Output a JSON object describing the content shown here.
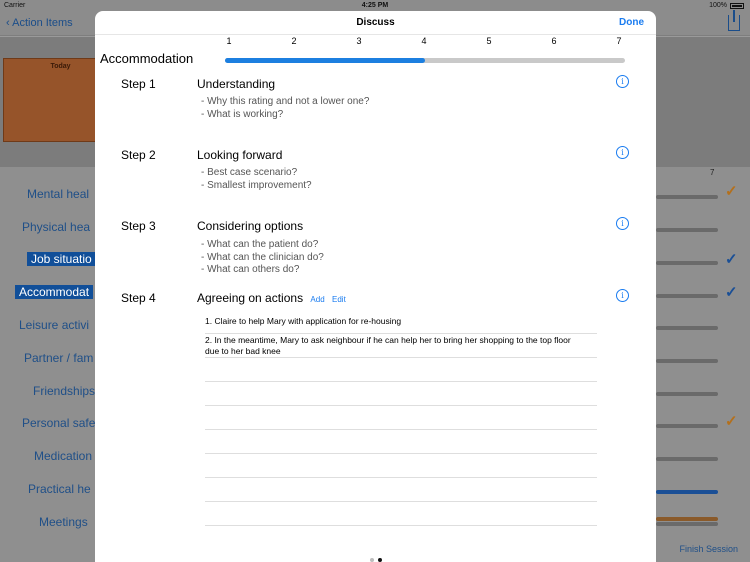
{
  "status": {
    "carrier": "Carrier",
    "time": "4:25 PM",
    "battery": "100%"
  },
  "nav": {
    "back_label": "Action Items"
  },
  "background": {
    "today_label": "Today",
    "items": [
      "Mental heal",
      "Physical hea",
      "Job situatio",
      "Accommodat",
      "Leisure activi",
      "Partner / fam",
      "Friendships",
      "Personal safe",
      "Medication",
      "Practical he",
      "Meetings"
    ],
    "scale_max_label": "7",
    "finish_label": "Finish Session"
  },
  "modal": {
    "title": "Discuss",
    "done_label": "Done",
    "category": "Accommodation",
    "scale_labels": [
      "1",
      "2",
      "3",
      "4",
      "5",
      "6",
      "7"
    ],
    "rating": 4,
    "steps": [
      {
        "label": "Step 1",
        "title": "Understanding",
        "questions": [
          "- Why this rating and not a lower one?",
          "- What is working?"
        ]
      },
      {
        "label": "Step 2",
        "title": "Looking forward",
        "questions": [
          "- Best case scenario?",
          "- Smallest improvement?"
        ]
      },
      {
        "label": "Step 3",
        "title": "Considering options",
        "questions": [
          "- What can the patient do?",
          "- What can the clinician do?",
          "- What can others do?"
        ]
      },
      {
        "label": "Step 4",
        "title": "Agreeing on actions",
        "add_label": "Add",
        "edit_label": "Edit"
      }
    ],
    "info_icon": "info-icon",
    "actions": [
      "1. Claire to help Mary with application for re-housing",
      "2. In the meantime, Mary to ask neighbour if he can help her to bring her shopping to the top floor due to her bad knee"
    ]
  },
  "colors": {
    "accent": "#1a7cf0",
    "track_fill": "#1c7fe0",
    "bg_dim": "#8f8f8f"
  }
}
